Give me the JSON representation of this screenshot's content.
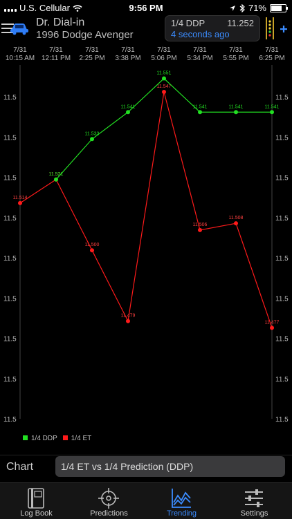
{
  "status": {
    "carrier": "U.S. Cellular",
    "time": "9:56 PM",
    "battery": "71%"
  },
  "header": {
    "title": "Dr. Dial-in",
    "subtitle": "1996 Dodge Avenger",
    "ddp_label": "1/4 DDP",
    "ddp_value": "11.252",
    "ddp_ago": "4 seconds ago"
  },
  "chart_data": {
    "type": "line",
    "categories": [
      [
        "7/31",
        "10:15 AM"
      ],
      [
        "7/31",
        "12:11 PM"
      ],
      [
        "7/31",
        "2:25 PM"
      ],
      [
        "7/31",
        "3:38 PM"
      ],
      [
        "7/31",
        "5:06 PM"
      ],
      [
        "7/31",
        "5:34 PM"
      ],
      [
        "7/31",
        "5:55 PM"
      ],
      [
        "7/31",
        "6:25 PM"
      ]
    ],
    "y_ticks": [
      "11.5",
      "11.5",
      "11.5",
      "11.5",
      "11.5",
      "11.5",
      "11.5",
      "11.5",
      "11.5"
    ],
    "ylim": [
      11.45,
      11.555
    ],
    "series": [
      {
        "name": "1/4 DDP",
        "color": "#22e022",
        "values": [
          null,
          11.521,
          11.533,
          11.541,
          11.551,
          11.541,
          11.541,
          11.541
        ],
        "labels": [
          "",
          "11.521",
          "11.533",
          "11.541",
          "11.551",
          "11.541",
          "11.541",
          "11.541"
        ]
      },
      {
        "name": "1/4 ET",
        "color": "#ff1a1a",
        "values": [
          11.514,
          11.521,
          11.5,
          11.479,
          11.547,
          11.506,
          11.508,
          11.477
        ],
        "labels": [
          "11.514",
          "11.521",
          "11.500",
          "11.479",
          "11.547",
          "11.506",
          "11.508",
          "11.477"
        ]
      }
    ]
  },
  "legend": [
    {
      "label": "1/4 DDP",
      "color": "#22e022"
    },
    {
      "label": "1/4 ET",
      "color": "#ff1a1a"
    }
  ],
  "chart_select": {
    "label": "Chart",
    "value": "1/4 ET vs 1/4 Prediction (DDP)"
  },
  "tabs": [
    {
      "label": "Log Book",
      "icon": "book-icon"
    },
    {
      "label": "Predictions",
      "icon": "crosshair-icon"
    },
    {
      "label": "Trending",
      "icon": "trend-icon"
    },
    {
      "label": "Settings",
      "icon": "sliders-icon"
    }
  ]
}
